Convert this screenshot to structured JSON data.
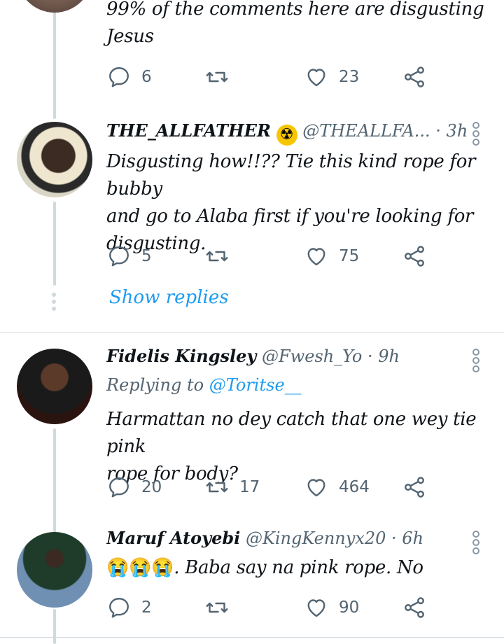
{
  "tweet0": {
    "lines": [
      "99% of the comments here are disgusting",
      "Jesus"
    ],
    "replies": "6",
    "retweets": "",
    "likes": "23"
  },
  "tweet1": {
    "name": "THE_ALLFATHER",
    "name_emoji": "☢",
    "handle": "@THEALLFA...",
    "time": "· 3h",
    "lines": [
      "Disgusting how!!?? Tie this kind rope for bubby",
      "and go to Alaba first if you're looking for",
      "disgusting."
    ],
    "replies": "5",
    "retweets": "",
    "likes": "75",
    "show_replies": "Show replies"
  },
  "tweet2": {
    "name": "Fidelis Kingsley",
    "handle": "@Fwesh_Yo",
    "time": "· 9h",
    "replying_prefix": "Replying to",
    "replying_to": "@Toritse__",
    "lines": [
      "Harmattan no dey catch that one wey tie pink",
      "rope for body?"
    ],
    "replies": "20",
    "retweets": "17",
    "likes": "464"
  },
  "tweet3": {
    "name": "Maruf Atoyebi",
    "handle": "@KingKennyx20",
    "time": "· 6h",
    "emojis": "😭😭😭",
    "text": ". Baba say na pink rope. No",
    "replies": "2",
    "retweets": "",
    "likes": "90"
  },
  "colors": {
    "accent": "#1d9bf0",
    "muted": "#536471",
    "line": "#cfd9de"
  },
  "icons": [
    "reply-icon",
    "retweet-icon",
    "like-icon",
    "share-icon",
    "more-icon",
    "radioactive-icon"
  ]
}
